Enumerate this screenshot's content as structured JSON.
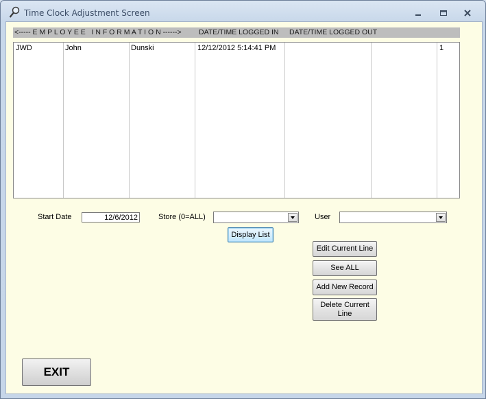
{
  "window": {
    "title": "Time Clock Adjustment Screen",
    "controls": {
      "minimize": "▁",
      "maximize": "▭",
      "close": "✕"
    }
  },
  "list": {
    "headers": {
      "employee": "<----- E M P L O Y E E   I N F O R M A T I O N ------>",
      "logged_in": "DATE/TIME LOGGED IN",
      "logged_out": "DATE/TIME LOGGED OUT"
    },
    "rows": [
      {
        "code": "JWD",
        "first": "John",
        "last": "Dunski",
        "logged_in": "12/12/2012 5:14:41 PM",
        "logged_out": "",
        "extra": "",
        "id": "1"
      }
    ]
  },
  "filters": {
    "start_date_label": "Start Date",
    "start_date_value": "12/6/2012",
    "store_label": "Store (0=ALL)",
    "store_value": "",
    "user_label": "User",
    "user_value": ""
  },
  "buttons": {
    "display_list": "Display List",
    "edit_current_line": "Edit Current Line",
    "see_all": "See ALL",
    "add_new_record": "Add New Record",
    "delete_current_line": "Delete Current Line",
    "exit": "EXIT"
  },
  "icons": {
    "title": "magnifier-icon",
    "dropdown": "chevron-down-icon"
  }
}
